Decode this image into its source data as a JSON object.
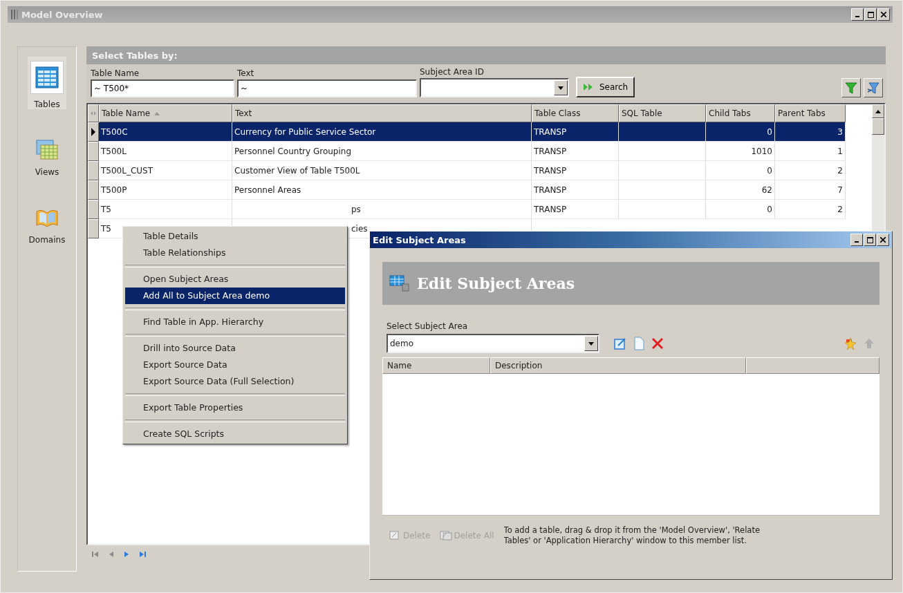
{
  "window": {
    "title": "Model Overview"
  },
  "sidebar": {
    "items": [
      {
        "label": "Tables",
        "selected": true
      },
      {
        "label": "Views",
        "selected": false
      },
      {
        "label": "Domains",
        "selected": false
      }
    ]
  },
  "filter": {
    "title": "Select Tables by:",
    "table_name": {
      "label": "Table Name",
      "value": "~ T500*"
    },
    "text": {
      "label": "Text",
      "value": "~"
    },
    "subject_area": {
      "label": "Subject Area ID"
    },
    "search_button": "Search"
  },
  "table": {
    "columns": [
      {
        "label": "Table Name",
        "sorted": true
      },
      {
        "label": "Text",
        "sorted": false
      },
      {
        "label": "Table Class",
        "sorted": false
      },
      {
        "label": "SQL Table",
        "sorted": false
      },
      {
        "label": "Child Tabs",
        "sorted": false
      },
      {
        "label": "Parent Tabs",
        "sorted": false
      }
    ],
    "rows": [
      {
        "kind": "full",
        "selected": true,
        "cells": [
          "T500C",
          "Currency for Public Service Sector",
          "TRANSP",
          "",
          "0",
          "3"
        ]
      },
      {
        "kind": "full",
        "selected": false,
        "cells": [
          "T500L",
          "Personnel Country Grouping",
          "TRANSP",
          "",
          "1010",
          "1"
        ]
      },
      {
        "kind": "full",
        "selected": false,
        "cells": [
          "T500L_CUST",
          "Customer View of Table T500L",
          "TRANSP",
          "",
          "0",
          "2"
        ]
      },
      {
        "kind": "full",
        "selected": false,
        "cells": [
          "T500P",
          "Personnel Areas",
          "TRANSP",
          "",
          "62",
          "7"
        ]
      },
      {
        "kind": "covered",
        "selected": false,
        "cells": [
          "T5",
          "ps",
          "TRANSP",
          "",
          "0",
          "2"
        ]
      },
      {
        "kind": "covered",
        "selected": false,
        "cells": [
          "T5",
          "cies"
        ]
      }
    ]
  },
  "context_menu": {
    "groups": [
      [
        {
          "label": "Table Details",
          "selected": false
        },
        {
          "label": "Table Relationships",
          "selected": false
        }
      ],
      [
        {
          "label": "Open Subject Areas",
          "selected": false
        },
        {
          "label": "Add All to Subject Area demo",
          "selected": true
        }
      ],
      [
        {
          "label": "Find Table in App. Hierarchy",
          "selected": false
        }
      ],
      [
        {
          "label": "Drill into Source Data",
          "selected": false
        },
        {
          "label": "Export Source Data",
          "selected": false
        },
        {
          "label": "Export Source Data (Full Selection)",
          "selected": false
        }
      ],
      [
        {
          "label": "Export Table Properties",
          "selected": false
        }
      ],
      [
        {
          "label": "Create SQL Scripts",
          "selected": false
        }
      ]
    ]
  },
  "dialog": {
    "title": "Edit Subject Areas",
    "heading": "Edit Subject Areas",
    "select_label": "Select Subject Area",
    "select_value": "demo",
    "columns": [
      "Name",
      "Description"
    ],
    "buttons": [
      {
        "label": "Delete",
        "disabled": true
      },
      {
        "label": "Delete All",
        "disabled": true
      }
    ],
    "hint_lines": [
      "To add a table, drag & drop it from the 'Model Overview', 'Relate",
      "Tables' or 'Application Hierarchy'  window to this member list."
    ]
  }
}
